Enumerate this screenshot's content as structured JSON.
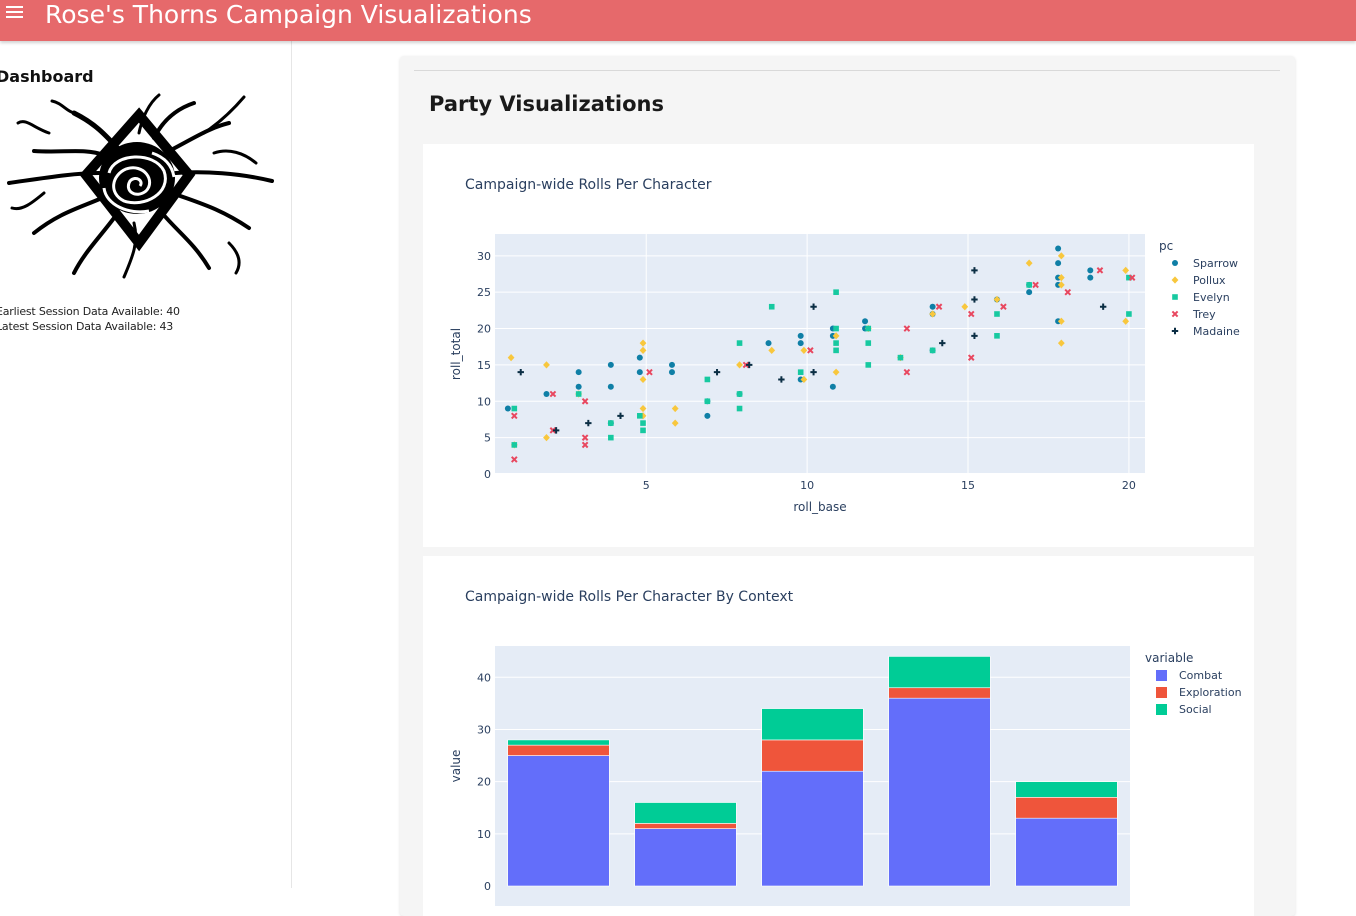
{
  "header": {
    "title": "Rose's Thorns Campaign Visualizations",
    "menu_icon": "hamburger-menu-icon",
    "accent": "#e6696b"
  },
  "sidebar": {
    "title": "Dashboard",
    "logo_icon": "thorned-rose-logo",
    "earliest_session": "Earliest Session Data Available: 40",
    "latest_session": "Latest Session Data Available: 43"
  },
  "main": {
    "section_title": "Party Visualizations"
  },
  "chart_data": [
    {
      "type": "scatter",
      "title": "Campaign-wide Rolls Per Character",
      "xlabel": "roll_base",
      "ylabel": "roll_total",
      "xlim": [
        0.3,
        20.5
      ],
      "ylim": [
        0,
        33
      ],
      "xticks": [
        5,
        10,
        15,
        20
      ],
      "yticks": [
        0,
        5,
        10,
        15,
        20,
        25,
        30
      ],
      "grid": true,
      "legend_title": "pc",
      "legend_position": "right",
      "series": [
        {
          "name": "Sparrow",
          "color": "#0f7fa6",
          "symbol": "circle",
          "points": [
            [
              0.7,
              9
            ],
            [
              1.9,
              11
            ],
            [
              2.9,
              14
            ],
            [
              2.9,
              12
            ],
            [
              3.9,
              15
            ],
            [
              3.9,
              12
            ],
            [
              3.9,
              7
            ],
            [
              4.8,
              16
            ],
            [
              4.8,
              14
            ],
            [
              5.8,
              15
            ],
            [
              5.8,
              14
            ],
            [
              6.9,
              10
            ],
            [
              6.9,
              8
            ],
            [
              7.9,
              11
            ],
            [
              8.8,
              18
            ],
            [
              9.8,
              19
            ],
            [
              9.8,
              18
            ],
            [
              9.8,
              13
            ],
            [
              10.8,
              20
            ],
            [
              10.8,
              19
            ],
            [
              10.8,
              12
            ],
            [
              11.8,
              21
            ],
            [
              11.8,
              20
            ],
            [
              13.9,
              23
            ],
            [
              13.9,
              22
            ],
            [
              13.9,
              17
            ],
            [
              15.9,
              24
            ],
            [
              16.9,
              26
            ],
            [
              16.9,
              25
            ],
            [
              17.8,
              31
            ],
            [
              17.8,
              29
            ],
            [
              17.8,
              27
            ],
            [
              17.8,
              26
            ],
            [
              17.8,
              21
            ],
            [
              18.8,
              28
            ],
            [
              18.8,
              27
            ]
          ]
        },
        {
          "name": "Pollux",
          "color": "#f8c73d",
          "symbol": "diamond",
          "points": [
            [
              0.8,
              16
            ],
            [
              0.9,
              4
            ],
            [
              1.9,
              15
            ],
            [
              1.9,
              5
            ],
            [
              2.9,
              11
            ],
            [
              4.9,
              18
            ],
            [
              4.9,
              17
            ],
            [
              4.9,
              13
            ],
            [
              4.9,
              9
            ],
            [
              4.9,
              8
            ],
            [
              5.9,
              9
            ],
            [
              5.9,
              7
            ],
            [
              7.9,
              15
            ],
            [
              8.9,
              17
            ],
            [
              9.9,
              17
            ],
            [
              9.9,
              13
            ],
            [
              10.9,
              19
            ],
            [
              10.9,
              14
            ],
            [
              11.9,
              20
            ],
            [
              12.9,
              16
            ],
            [
              13.9,
              22
            ],
            [
              14.9,
              23
            ],
            [
              15.9,
              24
            ],
            [
              16.9,
              29
            ],
            [
              17.9,
              30
            ],
            [
              17.9,
              27
            ],
            [
              17.9,
              26
            ],
            [
              17.9,
              21
            ],
            [
              17.9,
              18
            ],
            [
              19.9,
              28
            ],
            [
              19.9,
              21
            ]
          ]
        },
        {
          "name": "Evelyn",
          "color": "#17c9a0",
          "symbol": "square",
          "points": [
            [
              0.9,
              9
            ],
            [
              0.9,
              4
            ],
            [
              2.9,
              11
            ],
            [
              3.9,
              7
            ],
            [
              3.9,
              5
            ],
            [
              4.8,
              8
            ],
            [
              4.9,
              7
            ],
            [
              4.9,
              6
            ],
            [
              6.9,
              13
            ],
            [
              6.9,
              10
            ],
            [
              7.9,
              18
            ],
            [
              7.9,
              11
            ],
            [
              7.9,
              9
            ],
            [
              8.9,
              23
            ],
            [
              9.8,
              14
            ],
            [
              10.9,
              25
            ],
            [
              10.9,
              20
            ],
            [
              10.9,
              18
            ],
            [
              10.9,
              17
            ],
            [
              11.9,
              20
            ],
            [
              11.9,
              18
            ],
            [
              11.9,
              15
            ],
            [
              12.9,
              16
            ],
            [
              13.9,
              17
            ],
            [
              15.9,
              22
            ],
            [
              15.9,
              19
            ],
            [
              16.9,
              26
            ],
            [
              20.0,
              27
            ],
            [
              20.0,
              22
            ]
          ]
        },
        {
          "name": "Trey",
          "color": "#e8475f",
          "symbol": "x",
          "points": [
            [
              0.9,
              2
            ],
            [
              0.9,
              8
            ],
            [
              2.1,
              11
            ],
            [
              2.1,
              6
            ],
            [
              3.1,
              10
            ],
            [
              3.1,
              5
            ],
            [
              3.1,
              4
            ],
            [
              5.1,
              14
            ],
            [
              8.1,
              15
            ],
            [
              10.1,
              17
            ],
            [
              13.1,
              20
            ],
            [
              13.1,
              14
            ],
            [
              14.1,
              23
            ],
            [
              15.1,
              22
            ],
            [
              15.1,
              16
            ],
            [
              16.1,
              23
            ],
            [
              17.1,
              26
            ],
            [
              18.1,
              25
            ],
            [
              19.1,
              28
            ],
            [
              20.1,
              27
            ]
          ]
        },
        {
          "name": "Madaine",
          "color": "#0b2e44",
          "symbol": "cross",
          "points": [
            [
              1.1,
              14
            ],
            [
              2.2,
              6
            ],
            [
              3.2,
              7
            ],
            [
              4.2,
              8
            ],
            [
              7.2,
              14
            ],
            [
              8.2,
              15
            ],
            [
              9.2,
              13
            ],
            [
              10.2,
              23
            ],
            [
              10.2,
              14
            ],
            [
              14.2,
              18
            ],
            [
              15.2,
              28
            ],
            [
              15.2,
              24
            ],
            [
              15.2,
              19
            ],
            [
              19.2,
              23
            ]
          ]
        }
      ]
    },
    {
      "type": "bar",
      "title": "Campaign-wide Rolls Per Character By Context",
      "xlabel": "",
      "ylabel": "value",
      "ylim": [
        0,
        46
      ],
      "yticks": [
        0,
        10,
        20,
        30,
        40
      ],
      "grid": true,
      "stacked": true,
      "legend_title": "variable",
      "legend_position": "right",
      "categories": [
        "",
        "",
        "",
        "",
        ""
      ],
      "series": [
        {
          "name": "Combat",
          "color": "#636efa",
          "values": [
            25,
            11,
            22,
            36,
            13
          ]
        },
        {
          "name": "Exploration",
          "color": "#ef553b",
          "values": [
            2,
            1,
            6,
            2,
            4
          ]
        },
        {
          "name": "Social",
          "color": "#00cc96",
          "values": [
            1,
            4,
            6,
            6,
            3
          ]
        }
      ]
    }
  ]
}
